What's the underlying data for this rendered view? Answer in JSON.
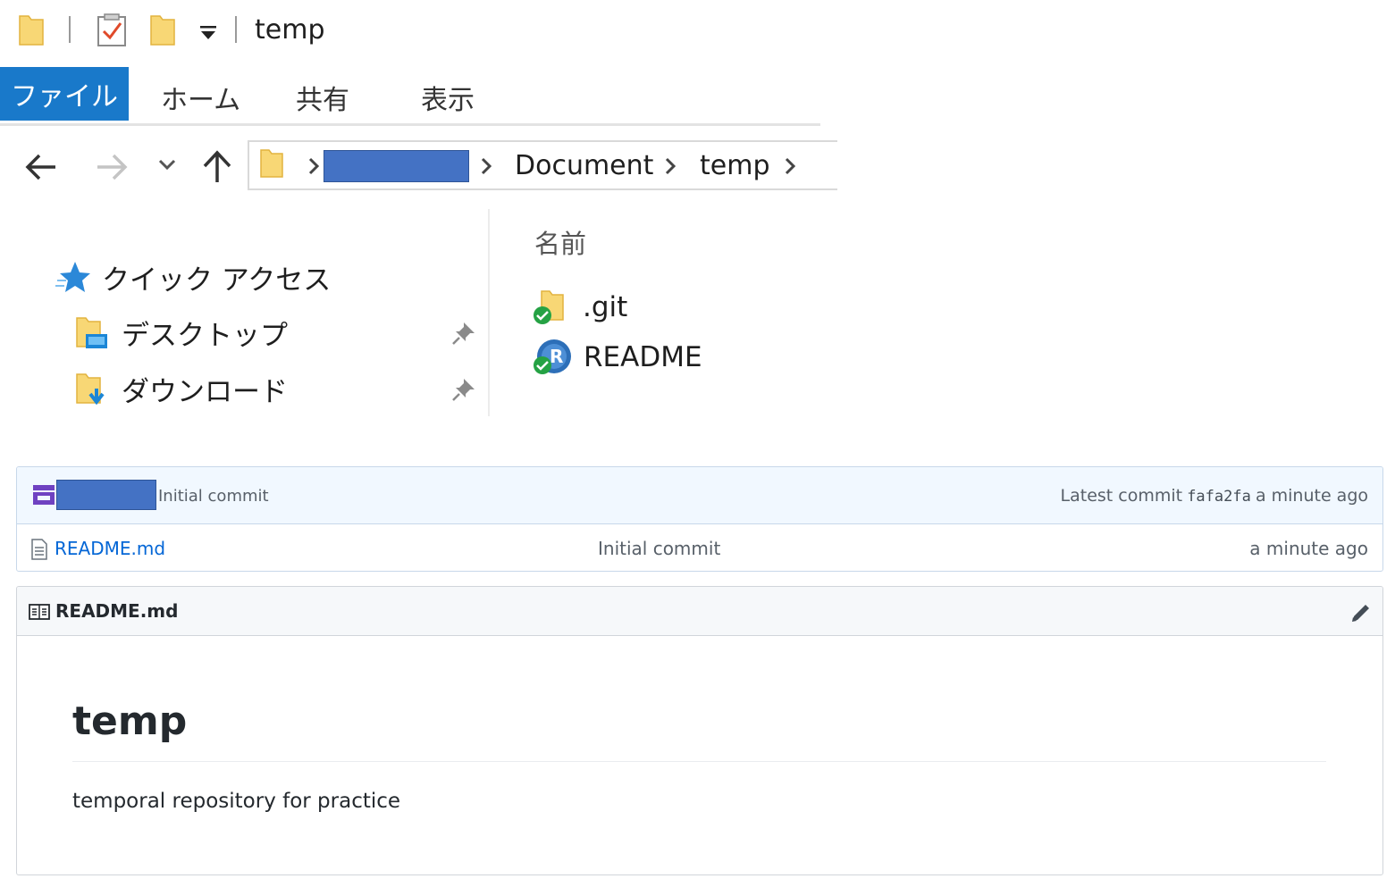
{
  "window": {
    "title": "temp"
  },
  "ribbon": {
    "tabs": [
      {
        "label": "ファイル",
        "active": true
      },
      {
        "label": "ホーム",
        "active": false
      },
      {
        "label": "共有",
        "active": false
      },
      {
        "label": "表示",
        "active": false
      }
    ]
  },
  "address_bar": {
    "crumbs": [
      "Document",
      "temp"
    ]
  },
  "nav_pane": {
    "quick_access_label": "クイック アクセス",
    "items": [
      {
        "label": "デスクトップ",
        "icon": "desktop-folder-icon",
        "pinned": true
      },
      {
        "label": "ダウンロード",
        "icon": "downloads-folder-icon",
        "pinned": true
      }
    ]
  },
  "file_list": {
    "column_name": "名前",
    "files": [
      {
        "name": ".git",
        "icon": "folder-icon",
        "status": "synced"
      },
      {
        "name": "README",
        "icon": "r-file-icon",
        "status": "synced"
      }
    ]
  },
  "github": {
    "commit_message": "Initial commit",
    "latest_commit_label": "Latest commit",
    "commit_hash": "fafa2fa",
    "commit_age": "a minute ago",
    "files": [
      {
        "name": "README.md",
        "message": "Initial commit",
        "age": "a minute ago"
      }
    ],
    "readme": {
      "filename": "README.md",
      "heading": "temp",
      "body": "temporal repository for practice"
    }
  },
  "colors": {
    "ribbon_accent": "#1979ca",
    "folder": "#f8d775",
    "redaction": "#4472c4",
    "github_link": "#0366d6",
    "status_green": "#25a244"
  }
}
